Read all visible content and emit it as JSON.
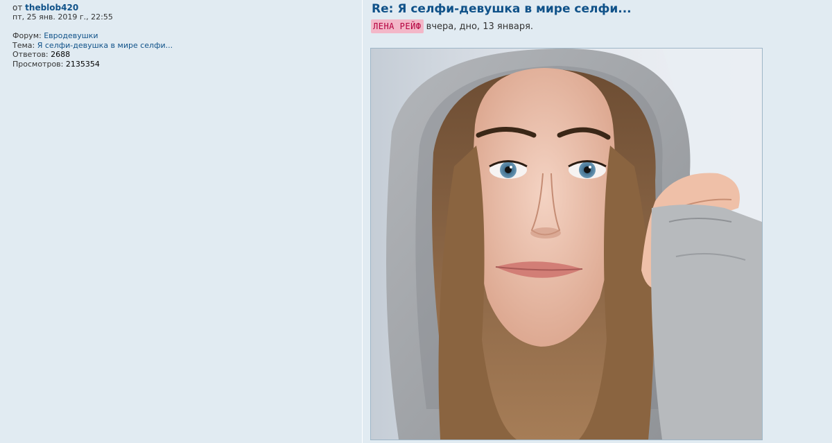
{
  "topic_summary": {
    "by_label": "от",
    "author": "theblob420",
    "date": "пт, 25 янв. 2019 г., 22:55",
    "forum_label": "Форум:",
    "forum_name": "Евродевушки",
    "topic_label": "Тема:",
    "topic_name": "Я селфи-девушка в мире селфи...",
    "replies_label": "Ответов:",
    "replies_count": "2688",
    "views_label": "Просмотров:",
    "views_count": "2135354"
  },
  "post": {
    "title": "Re: Я селфи-девушка в мире селфи...",
    "author_badge": "ЛЕНА РЕЙФ",
    "meta_text": "вчера, дно, 13 января."
  },
  "colors": {
    "background": "#e1ebf2",
    "link": "#105289",
    "badge_bg": "#f3b7c8",
    "badge_text": "#b4003e"
  },
  "icons": {
    "photo": "selfie-photo"
  }
}
